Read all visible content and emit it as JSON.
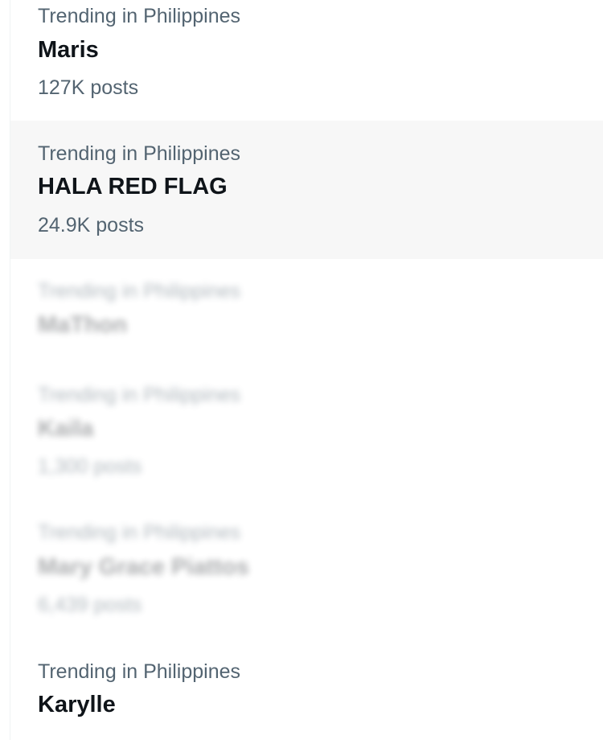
{
  "trends": [
    {
      "context": "Trending in Philippines",
      "name": "Maris",
      "posts": "127K posts",
      "blurred": false
    },
    {
      "context": "Trending in Philippines",
      "name": "HALA RED FLAG",
      "posts": "24.9K posts",
      "blurred": false
    },
    {
      "context": "Trending in Philippines",
      "name": "MaThon",
      "posts": "",
      "blurred": true
    },
    {
      "context": "Trending in Philippines",
      "name": "Kaila",
      "posts": "1,300 posts",
      "blurred": true
    },
    {
      "context": "Trending in Philippines",
      "name": "Mary Grace Piattos",
      "posts": "6,439 posts",
      "blurred": true
    },
    {
      "context": "Trending in Philippines",
      "name": "Karylle",
      "posts": "",
      "blurred": false
    }
  ]
}
